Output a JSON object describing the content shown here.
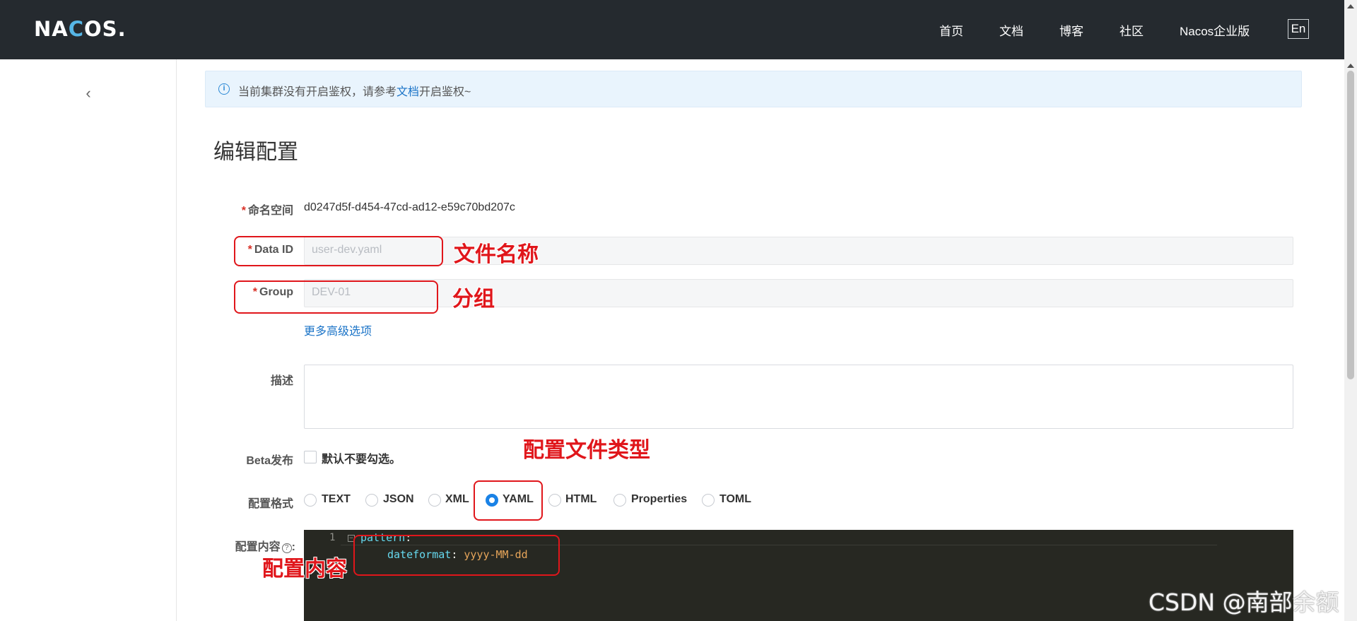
{
  "header": {
    "logo": [
      "NA",
      "C",
      "O",
      "S",
      "."
    ],
    "nav": [
      "首页",
      "文档",
      "博客",
      "社区",
      "Nacos企业版"
    ],
    "lang": "En"
  },
  "sidebar": {
    "collapse_icon": "chevron-left-icon"
  },
  "alert": {
    "icon": "info-icon",
    "text_before": "当前集群没有开启鉴权，请参考",
    "link": "文档",
    "text_after": "开启鉴权~"
  },
  "page_title": "编辑配置",
  "form": {
    "namespace": {
      "label": "命名空间",
      "value": "d0247d5f-d454-47cd-ad12-e59c70bd207c"
    },
    "data_id": {
      "label": "Data ID",
      "value": "user-dev.yaml"
    },
    "group": {
      "label": "Group",
      "value": "DEV-01"
    },
    "advanced_link": "更多高级选项",
    "description": {
      "label": "描述",
      "value": ""
    },
    "beta": {
      "label": "Beta发布",
      "checkbox_label": "默认不要勾选。",
      "checked": false
    },
    "format": {
      "label": "配置格式",
      "options": [
        "TEXT",
        "JSON",
        "XML",
        "YAML",
        "HTML",
        "Properties",
        "TOML"
      ],
      "selected": "YAML"
    },
    "content": {
      "label": "配置内容",
      "help_icon": "question-circle-icon",
      "colon": ":",
      "lines": [
        {
          "no": "1",
          "key": "pattern",
          "sep": ":",
          "value": ""
        },
        {
          "no": "",
          "key": "dateformat",
          "sep": ":",
          "value": " yyyy-MM-dd"
        }
      ]
    }
  },
  "annotations": {
    "data_id": "文件名称",
    "group": "分组",
    "format": "配置文件类型",
    "content": "配置内容"
  },
  "watermark": "CSDN @南部余额",
  "colors": {
    "header_bg": "#252a2f",
    "accent": "#1a82e6",
    "annotation": "#e0161b",
    "editor_bg": "#272822"
  }
}
